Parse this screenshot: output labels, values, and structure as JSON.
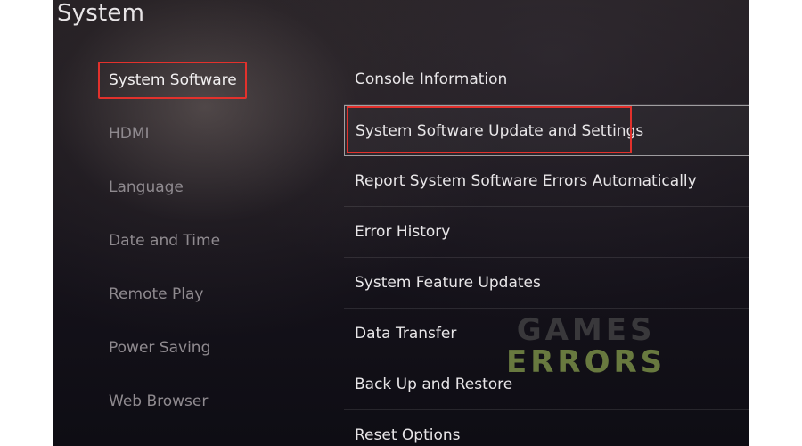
{
  "header": {
    "title": "System"
  },
  "left_menu": {
    "items": [
      {
        "label": "System Software",
        "active": true
      },
      {
        "label": "HDMI",
        "active": false
      },
      {
        "label": "Language",
        "active": false
      },
      {
        "label": "Date and Time",
        "active": false
      },
      {
        "label": "Remote Play",
        "active": false
      },
      {
        "label": "Power Saving",
        "active": false
      },
      {
        "label": "Web Browser",
        "active": false
      }
    ]
  },
  "right_menu": {
    "items": [
      {
        "label": "Console Information"
      },
      {
        "label": "System Software Update and Settings",
        "focused": true
      },
      {
        "label": "Report System Software Errors Automatically"
      },
      {
        "label": "Error History"
      },
      {
        "label": "System Feature Updates"
      },
      {
        "label": "Data Transfer"
      },
      {
        "label": "Back Up and Restore"
      },
      {
        "label": "Reset Options"
      }
    ]
  },
  "watermark": {
    "line1": "GAMES",
    "line2": "ERRORS"
  },
  "colors": {
    "highlight_red": "#e2312c",
    "watermark_green": "#788c46"
  }
}
